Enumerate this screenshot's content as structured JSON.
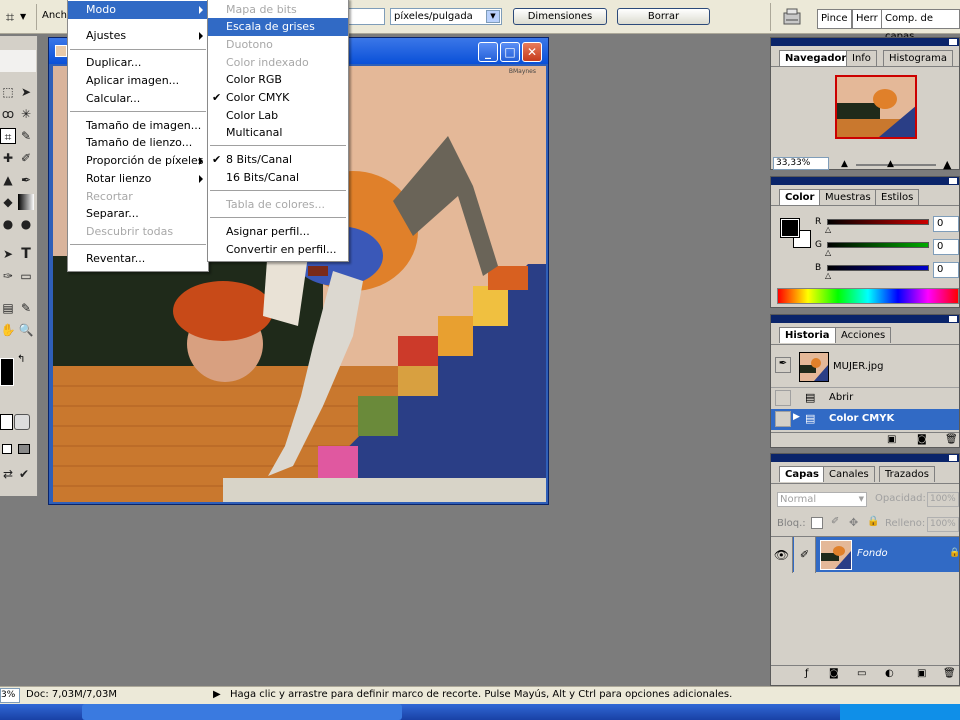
{
  "options_bar": {
    "width_label": "Anch",
    "units_select": "píxeles/pulgada",
    "dimensions_button": "Dimensiones",
    "clear_button": "Borrar",
    "well_tabs": [
      "Pince",
      "Herr",
      "Comp. de capas"
    ]
  },
  "image_menu": {
    "items": [
      {
        "label": "Modo",
        "state": "selected",
        "submenu": true
      },
      {
        "label": "Ajustes",
        "state": "normal",
        "submenu": true
      },
      {
        "label": "Duplicar...",
        "state": "normal"
      },
      {
        "label": "Aplicar imagen...",
        "state": "normal"
      },
      {
        "label": "Calcular...",
        "state": "normal"
      },
      {
        "label": "Tamaño de imagen...",
        "state": "normal"
      },
      {
        "label": "Tamaño de lienzo...",
        "state": "normal"
      },
      {
        "label": "Proporción de píxeles",
        "state": "normal",
        "submenu": true
      },
      {
        "label": "Rotar lienzo",
        "state": "normal",
        "submenu": true
      },
      {
        "label": "Recortar",
        "state": "disabled"
      },
      {
        "label": "Separar...",
        "state": "normal"
      },
      {
        "label": "Descubrir todas",
        "state": "disabled"
      },
      {
        "label": "Reventar...",
        "state": "normal"
      }
    ]
  },
  "mode_submenu": {
    "items": [
      {
        "label": "Mapa de bits",
        "state": "disabled"
      },
      {
        "label": "Escala de grises",
        "state": "highlighted"
      },
      {
        "label": "Duotono",
        "state": "disabled"
      },
      {
        "label": "Color indexado",
        "state": "disabled"
      },
      {
        "label": "Color RGB",
        "state": "normal"
      },
      {
        "label": "Color CMYK",
        "state": "checked"
      },
      {
        "label": "Color Lab",
        "state": "normal"
      },
      {
        "label": "Multicanal",
        "state": "normal"
      },
      {
        "label": "8 Bits/Canal",
        "state": "checked"
      },
      {
        "label": "16 Bits/Canal",
        "state": "normal"
      },
      {
        "label": "Tabla de colores...",
        "state": "disabled"
      },
      {
        "label": "Asignar perfil...",
        "state": "normal"
      },
      {
        "label": "Convertir en perfil...",
        "state": "normal"
      }
    ]
  },
  "document": {
    "signature": "BMaynes"
  },
  "navigator_panel": {
    "tabs": [
      "Navegador",
      "Info",
      "Histograma"
    ],
    "zoom": "33,33%"
  },
  "color_panel": {
    "tabs": [
      "Color",
      "Muestras",
      "Estilos"
    ],
    "channels": [
      {
        "label": "R",
        "value": "0",
        "color": "#cc0000"
      },
      {
        "label": "G",
        "value": "0",
        "color": "#00aa00"
      },
      {
        "label": "B",
        "value": "0",
        "color": "#0000cc"
      }
    ]
  },
  "history_panel": {
    "tabs": [
      "Historia",
      "Acciones"
    ],
    "snapshot": "MUJER.jpg",
    "states": [
      {
        "label": "Abrir",
        "active": false
      },
      {
        "label": "Color CMYK",
        "active": true
      }
    ]
  },
  "layers_panel": {
    "tabs": [
      "Capas",
      "Canales",
      "Trazados"
    ],
    "blend_mode": "Normal",
    "opacity_label": "Opacidad:",
    "opacity_value": "100%",
    "lock_label": "Bloq.:",
    "fill_label": "Relleno:",
    "fill_value": "100%",
    "layers": [
      {
        "name": "Fondo"
      }
    ]
  },
  "status_bar": {
    "zoom": "3%",
    "doc_size": "Doc: 7,03M/7,03M",
    "hint": "Haga clic y arrastre para definir marco de recorte. Pulse Mayús, Alt y Ctrl para opciones adicionales."
  },
  "colors": {
    "accent": "#316ac5",
    "panel_title": "#0a246a",
    "window_title": "#0a50d8"
  }
}
